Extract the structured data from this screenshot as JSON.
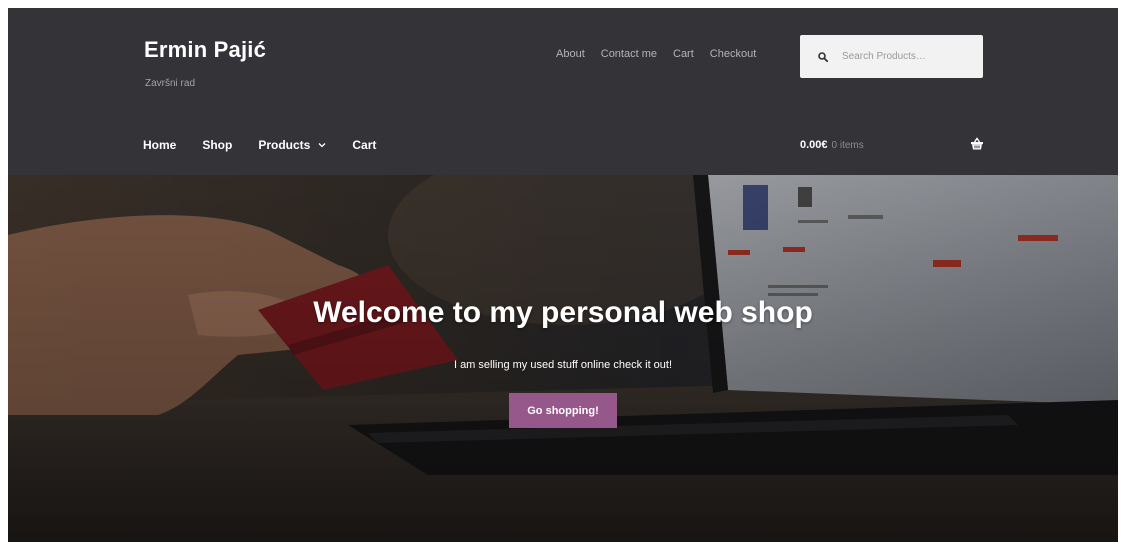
{
  "site": {
    "title": "Ermin Pajić",
    "tagline": "Završni rad"
  },
  "top_nav": {
    "items": [
      {
        "label": "About"
      },
      {
        "label": "Contact me"
      },
      {
        "label": "Cart"
      },
      {
        "label": "Checkout"
      }
    ]
  },
  "search": {
    "placeholder": "Search Products…",
    "icon": "search-icon"
  },
  "main_nav": {
    "items": [
      {
        "label": "Home"
      },
      {
        "label": "Shop"
      },
      {
        "label": "Products",
        "has_dropdown": true
      },
      {
        "label": "Cart"
      }
    ]
  },
  "cart": {
    "total": "0.00€",
    "count": "0 items",
    "icon": "basket-icon"
  },
  "hero": {
    "title": "Welcome to my personal web shop",
    "subtitle": "I am selling my used stuff online check it out!",
    "button_label": "Go shopping!"
  },
  "colors": {
    "header_bg": "#333338",
    "button_bg": "#96588a",
    "text_light": "#ffffff"
  }
}
